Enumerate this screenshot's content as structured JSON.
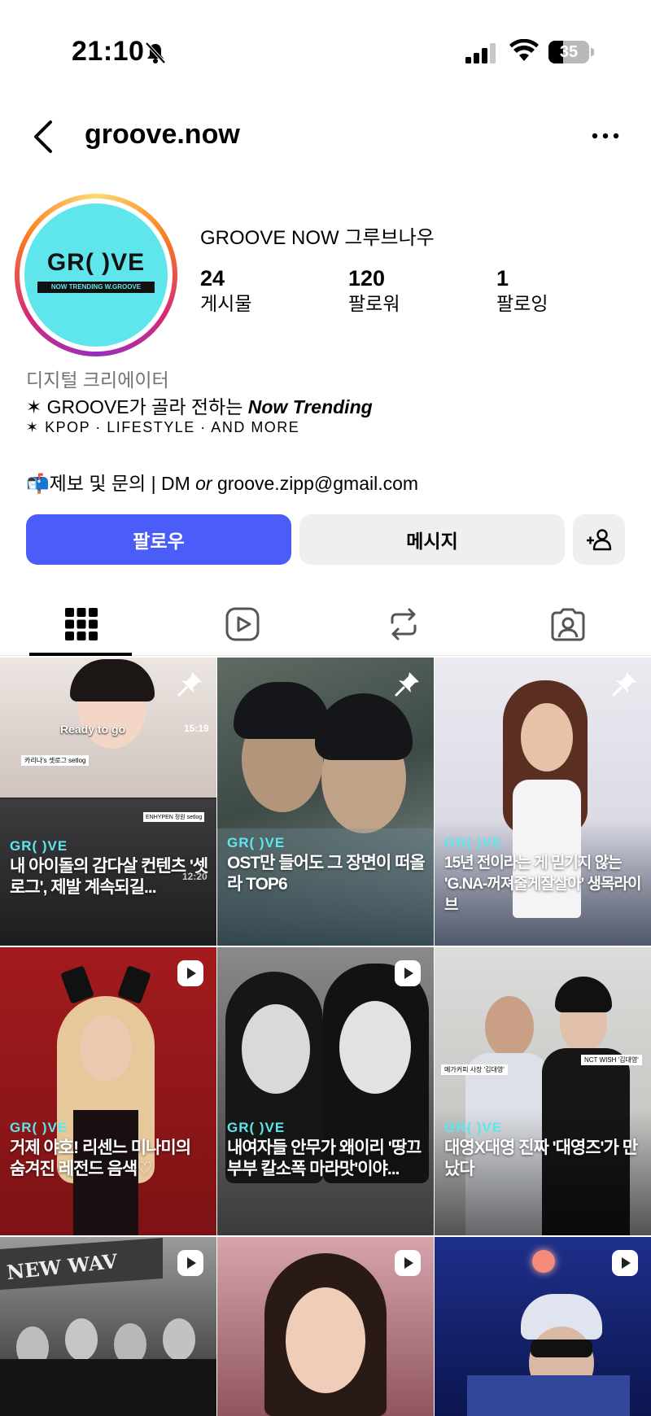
{
  "status_bar": {
    "time": "21:10",
    "battery": "35",
    "battery_level": 0.35
  },
  "header": {
    "username": "groove.now"
  },
  "avatar": {
    "logo_text": "GR(    )VE",
    "logo_sub": "NOW TRENDING W.GROOVE"
  },
  "profile": {
    "display_name": "GROOVE NOW 그루브나우",
    "stats": [
      {
        "count": "24",
        "label": "게시물"
      },
      {
        "count": "120",
        "label": "팔로워"
      },
      {
        "count": "1",
        "label": "팔로잉"
      }
    ],
    "category": "디지털 크리에이터",
    "bio_line1_prefix": "✶ GROOVE가 골라 전하는 ",
    "bio_line1_em": "Now Trending",
    "bio_line2": "✶ KPOP · LIFESTYLE · AND MORE",
    "bio_line3_prefix": "📬제보 및 문의 | DM ",
    "bio_line3_or": "or",
    "bio_line3_email": " groove.zipp@gmail.com"
  },
  "buttons": {
    "follow": "팔로우",
    "message": "메시지"
  },
  "tabs": [
    "grid-icon",
    "reels-icon",
    "reposts-icon",
    "tagged-icon"
  ],
  "grid": {
    "logo": "GR(    )VE",
    "posts": [
      {
        "caption": "내 아이돌의 감다살 컨텐츠 '셋로그', 제발 계속되길...",
        "type": "pinned",
        "ready": "Ready to go",
        "duration": "15:19",
        "duration2": "12:20",
        "tag1": "카리나's 셋로그 setlog",
        "tag2": "ENHYPEN 정원 setlog"
      },
      {
        "caption": "OST만 들어도 그 장면이 떠올라 TOP6",
        "type": "pinned"
      },
      {
        "caption": "15년 전이라는 게 믿기지 않는 'G.NA-꺼져줄게잘살아' 생목라이브",
        "type": "pinned"
      },
      {
        "caption": "거제 야호! 리센느 미나미의 숨겨진 레전드 음색♡",
        "type": "reel"
      },
      {
        "caption": "내여자들 안무가 왜이리 '땅끄부부 칼소폭 마라맛'이야...",
        "type": "reel"
      },
      {
        "caption": "대영X대영 진짜 '대영즈'가 만났다",
        "type": "reel",
        "tag1": "메가커피 사장 '김대영'",
        "tag2": "NCT WISH '김대영'"
      },
      {
        "caption": "",
        "type": "reel",
        "sign": "NEW WAV"
      },
      {
        "caption": "",
        "type": "reel"
      },
      {
        "caption": "",
        "type": "reel"
      }
    ]
  },
  "colors": {
    "follow": "#4a5df9",
    "logo_cyan": "#5ee6ec",
    "secondary_btn": "#efeff0"
  }
}
